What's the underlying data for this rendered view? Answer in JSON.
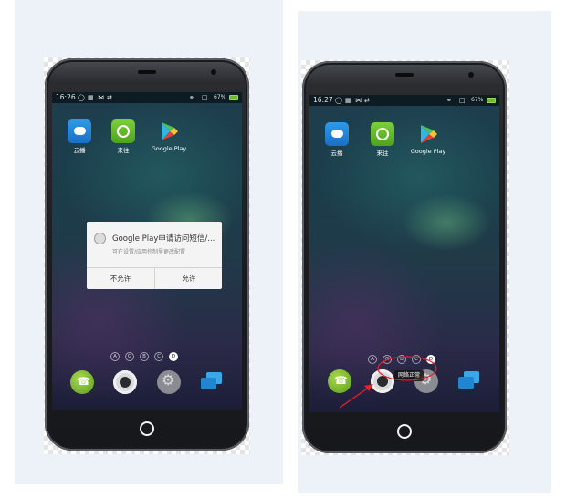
{
  "left_phone": {
    "status_time": "16:26",
    "battery_percent": "67%",
    "apps": [
      {
        "label": "云播",
        "icon": "cloud-play-icon"
      },
      {
        "label": "来往",
        "icon": "laiwang-icon"
      },
      {
        "label": "Google Play",
        "icon": "google-play-icon"
      }
    ],
    "dialog": {
      "title": "Google Play申请访问短信/...",
      "subtitle": "可在设置/应用控制里更改配置",
      "deny_label": "不允许",
      "allow_label": "允许"
    },
    "page_dots": [
      "A",
      "G",
      "B",
      "C",
      "D"
    ],
    "active_dot": "D"
  },
  "right_phone": {
    "status_time": "16:27",
    "battery_percent": "67%",
    "apps": [
      {
        "label": "云播",
        "icon": "cloud-play-icon"
      },
      {
        "label": "来往",
        "icon": "laiwang-icon"
      },
      {
        "label": "Google Play",
        "icon": "google-play-icon"
      }
    ],
    "page_dots": [
      "A",
      "G",
      "B",
      "C",
      "D"
    ],
    "active_dot": "D",
    "toast": "网络正常"
  },
  "dock_icons": [
    "phone-icon",
    "camera-icon",
    "settings-icon",
    "messages-icon"
  ],
  "colors": {
    "annotation": "#e8212b",
    "battery": "#6bbd2e",
    "panel": "#edf1f8"
  }
}
